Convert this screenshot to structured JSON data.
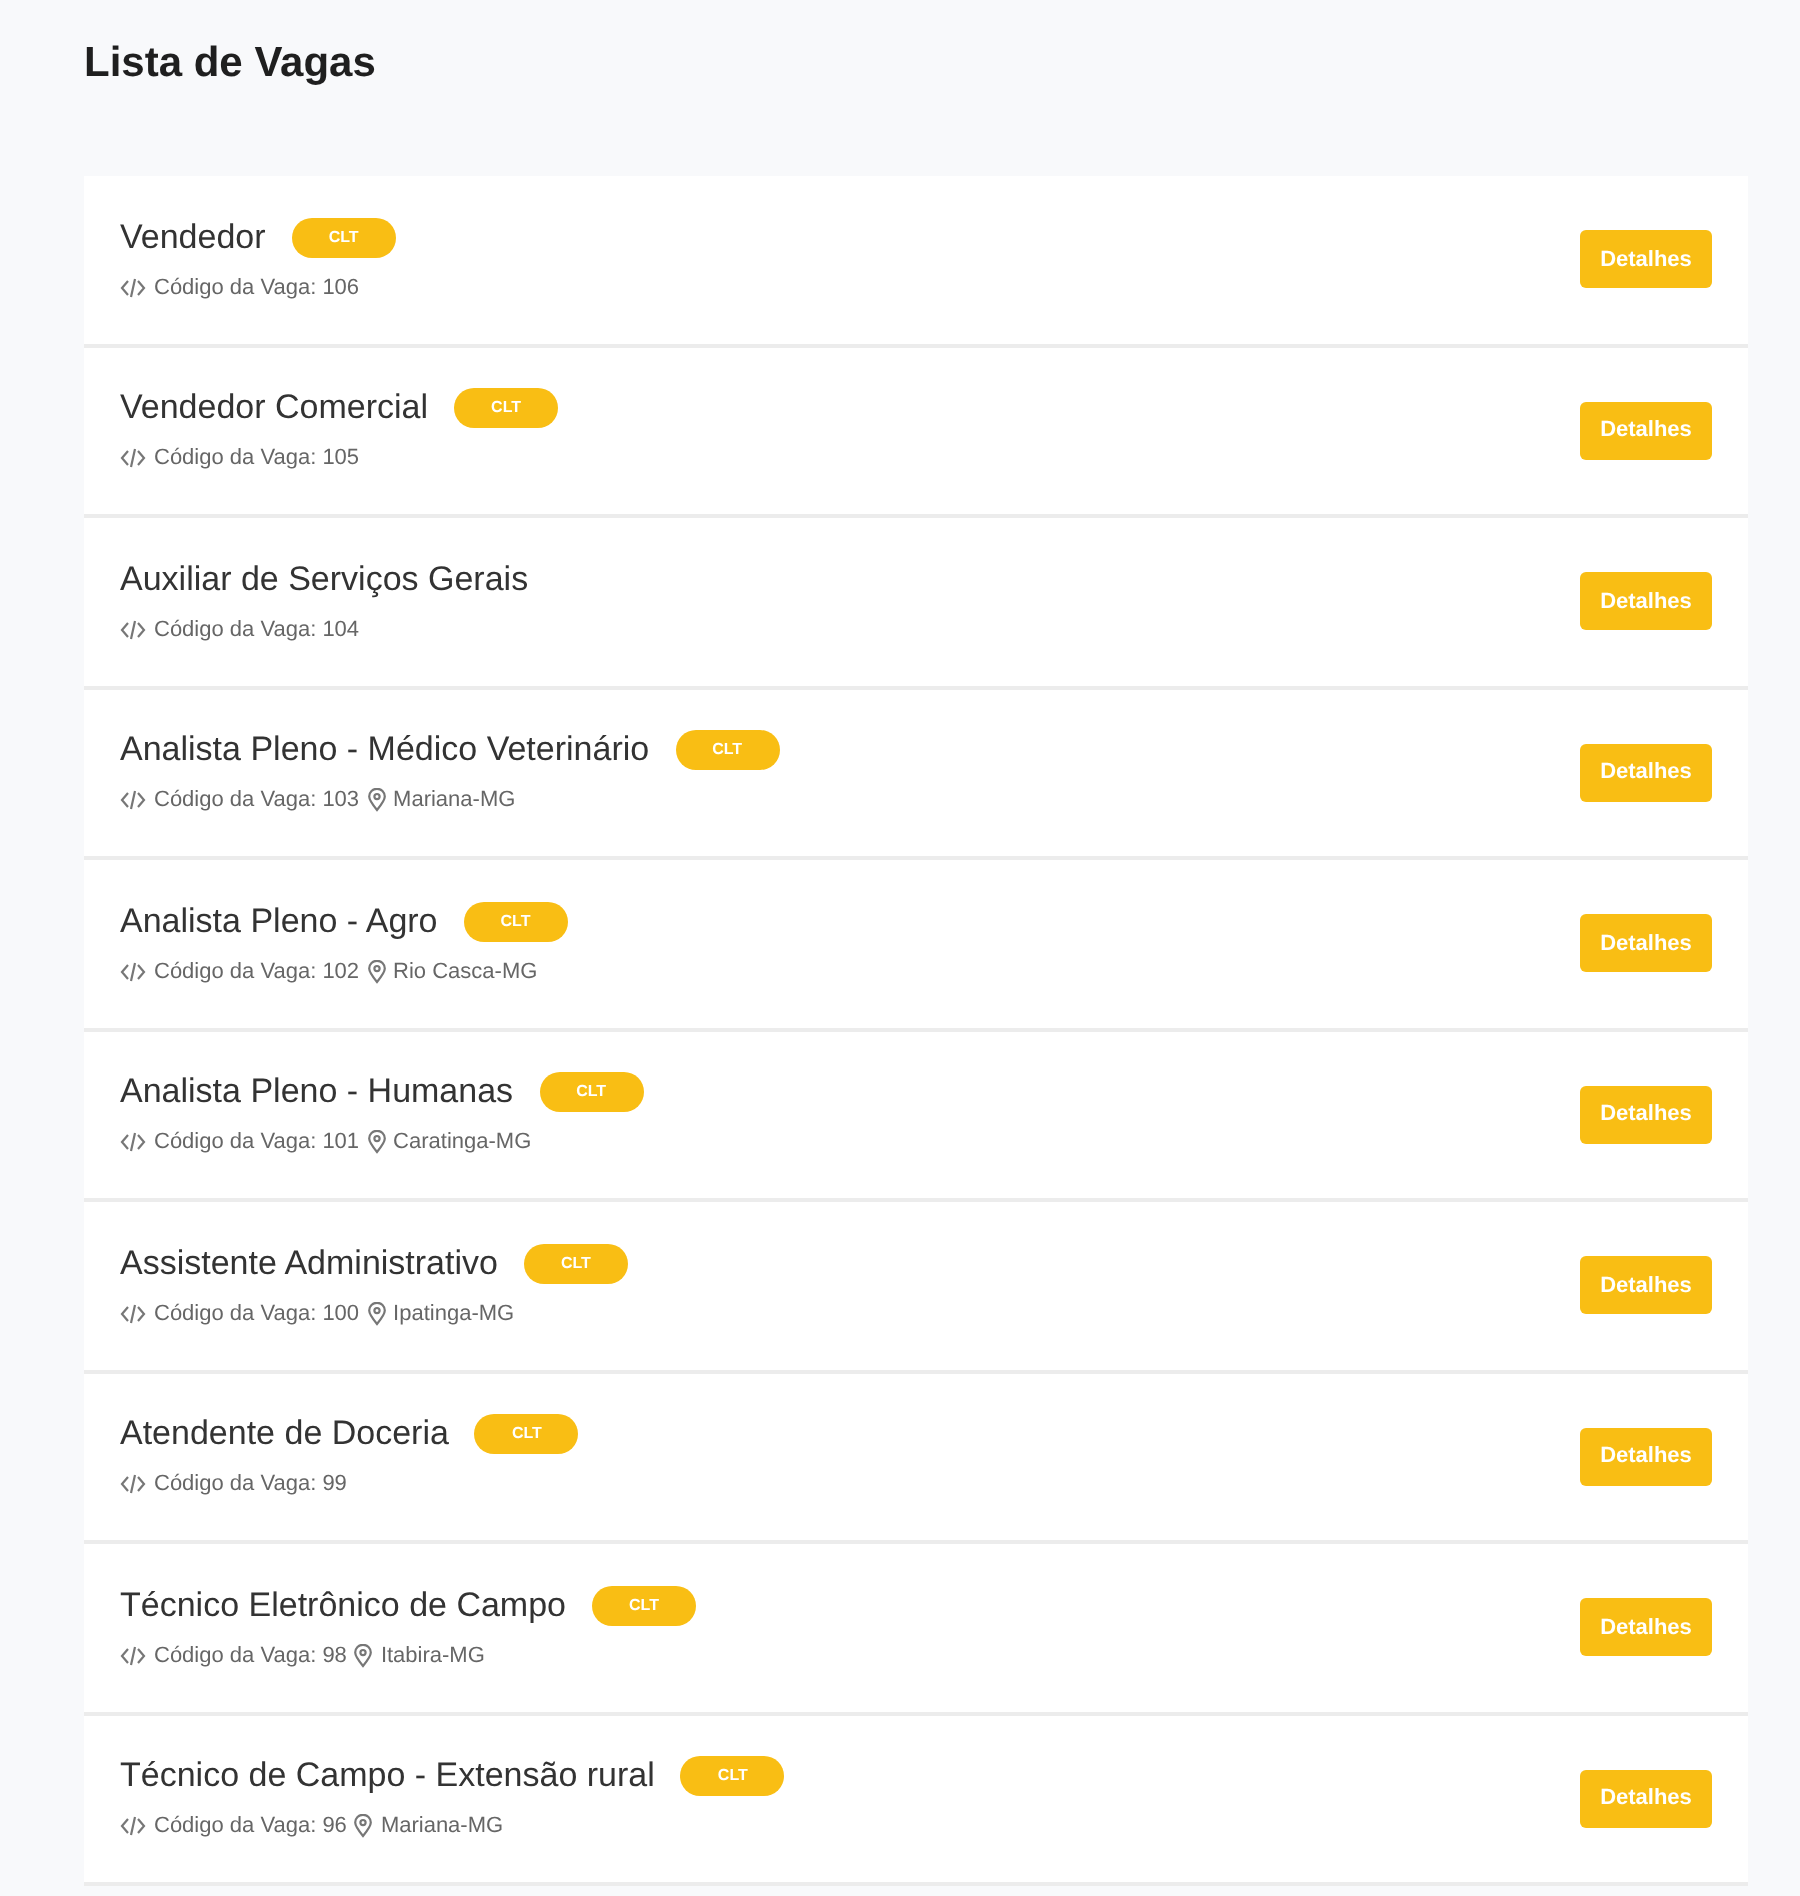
{
  "title": "Lista de Vagas",
  "jobs": [
    {
      "title": "Vendedor",
      "badge": "CLT",
      "code": "Código da Vaga: 106",
      "button": "Detalhes"
    },
    {
      "title": "Vendedor Comercial",
      "badge": "CLT",
      "code": "Código da Vaga: 105",
      "button": "Detalhes"
    },
    {
      "title": "Auxiliar de Serviços Gerais",
      "code": "Código da Vaga: 104",
      "button": "Detalhes"
    },
    {
      "title": "Analista Pleno - Médico Veterinário",
      "badge": "CLT",
      "code": "Código da Vaga: 103",
      "location": "Mariana-MG",
      "button": "Detalhes"
    },
    {
      "title": "Analista Pleno - Agro",
      "badge": "CLT",
      "code": "Código da Vaga: 102",
      "location": "Rio Casca-MG",
      "button": "Detalhes"
    },
    {
      "title": "Analista Pleno - Humanas",
      "badge": "CLT",
      "code": "Código da Vaga: 101",
      "location": "Caratinga-MG",
      "button": "Detalhes"
    },
    {
      "title": "Assistente Administrativo",
      "badge": "CLT",
      "code": "Código da Vaga: 100",
      "location": "Ipatinga-MG",
      "button": "Detalhes"
    },
    {
      "title": "Atendente de Doceria",
      "badge": "CLT",
      "code": "Código da Vaga: 99",
      "button": "Detalhes"
    },
    {
      "title": "Técnico Eletrônico de Campo",
      "badge": "CLT",
      "code": "Código da Vaga: 98",
      "location": "Itabira-MG",
      "button": "Detalhes"
    },
    {
      "title": "Técnico de Campo - Extensão rural",
      "badge": "CLT",
      "code": "Código da Vaga: 96",
      "location": "Mariana-MG",
      "button": "Detalhes"
    }
  ]
}
